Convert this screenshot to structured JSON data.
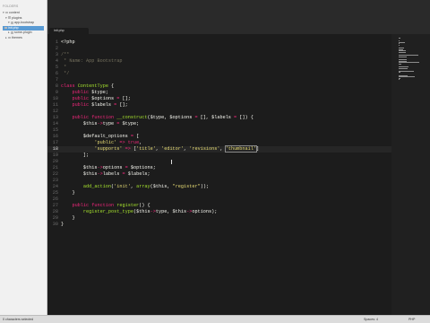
{
  "sidebar": {
    "header": "FOLDERS",
    "items": [
      {
        "label": "content",
        "caret": "▾",
        "depth": 0
      },
      {
        "label": "plugins",
        "caret": "▾",
        "depth": 1
      },
      {
        "label": "app-bootstrap",
        "caret": "▾",
        "depth": 2
      },
      {
        "label": "init.php",
        "caret": "",
        "depth": 3,
        "selected": true
      },
      {
        "label": "some-plugin",
        "caret": "▸",
        "depth": 2
      },
      {
        "label": "themes",
        "caret": "▸",
        "depth": 1
      }
    ]
  },
  "tab": {
    "label": "init.php"
  },
  "editor": {
    "current_line": 18,
    "lines": [
      [
        [
          "<?php",
          "v"
        ]
      ],
      [
        [
          "",
          ""
        ]
      ],
      [
        [
          "/**",
          "c"
        ]
      ],
      [
        [
          " * Name: App Bootstrap",
          "c"
        ]
      ],
      [
        [
          " *",
          "c"
        ]
      ],
      [
        [
          " */",
          "c"
        ]
      ],
      [
        [
          "",
          ""
        ]
      ],
      [
        [
          "class ",
          "k"
        ],
        [
          "ContentType",
          "f"
        ],
        [
          " {",
          "v"
        ]
      ],
      [
        [
          "    ",
          ""
        ],
        [
          "public ",
          "k"
        ],
        [
          "$type;",
          "v"
        ]
      ],
      [
        [
          "    ",
          ""
        ],
        [
          "public ",
          "k"
        ],
        [
          "$options ",
          "v"
        ],
        [
          "= ",
          "k"
        ],
        [
          "[];",
          "v"
        ]
      ],
      [
        [
          "    ",
          ""
        ],
        [
          "public ",
          "k"
        ],
        [
          "$labels ",
          "v"
        ],
        [
          "= ",
          "k"
        ],
        [
          "[];",
          "v"
        ]
      ],
      [
        [
          "",
          ""
        ]
      ],
      [
        [
          "    ",
          ""
        ],
        [
          "public function ",
          "k"
        ],
        [
          "__construct",
          "f"
        ],
        [
          "($type, $options ",
          "v"
        ],
        [
          "= ",
          "k"
        ],
        [
          "[], $labels ",
          "v"
        ],
        [
          "= ",
          "k"
        ],
        [
          "[]) {",
          "v"
        ]
      ],
      [
        [
          "        $this",
          "v"
        ],
        [
          "->",
          "k"
        ],
        [
          "type ",
          "v"
        ],
        [
          "= ",
          "k"
        ],
        [
          "$type;",
          "v"
        ]
      ],
      [
        [
          "",
          ""
        ]
      ],
      [
        [
          "        $default_options ",
          "v"
        ],
        [
          "= ",
          "k"
        ],
        [
          "[",
          "v"
        ]
      ],
      [
        [
          "            ",
          ""
        ],
        [
          "'public' ",
          "s"
        ],
        [
          "=> ",
          "k"
        ],
        [
          "true",
          "k"
        ],
        [
          ",",
          "v"
        ]
      ],
      [
        [
          "            ",
          ""
        ],
        [
          "'supports' ",
          "s"
        ],
        [
          "=> ",
          "k"
        ],
        [
          "[",
          "v"
        ],
        [
          "'title'",
          "s"
        ],
        [
          ", ",
          "v"
        ],
        [
          "'editor'",
          "s"
        ],
        [
          ", ",
          "v"
        ],
        [
          "'revisions'",
          "s"
        ],
        [
          ", ",
          "v"
        ],
        [
          "'thumbnail'",
          "s"
        ],
        [
          "]",
          "v"
        ]
      ],
      [
        [
          "        ];",
          "v"
        ]
      ],
      [
        [
          "",
          ""
        ]
      ],
      [
        [
          "        $this",
          "v"
        ],
        [
          "->",
          "k"
        ],
        [
          "options ",
          "v"
        ],
        [
          "= ",
          "k"
        ],
        [
          "$options;",
          "v"
        ]
      ],
      [
        [
          "        $this",
          "v"
        ],
        [
          "->",
          "k"
        ],
        [
          "labels ",
          "v"
        ],
        [
          "= ",
          "k"
        ],
        [
          "$labels;",
          "v"
        ]
      ],
      [
        [
          "",
          ""
        ]
      ],
      [
        [
          "        ",
          ""
        ],
        [
          "add_action",
          "f"
        ],
        [
          "(",
          "v"
        ],
        [
          "'init'",
          "s"
        ],
        [
          ", ",
          "v"
        ],
        [
          "array",
          "f"
        ],
        [
          "($this, ",
          "v"
        ],
        [
          "\"register\"",
          "s"
        ],
        [
          "));",
          "v"
        ]
      ],
      [
        [
          "    }",
          "v"
        ]
      ],
      [
        [
          "",
          ""
        ]
      ],
      [
        [
          "    ",
          ""
        ],
        [
          "public function ",
          "k"
        ],
        [
          "register",
          "f"
        ],
        [
          "() {",
          "v"
        ]
      ],
      [
        [
          "        ",
          ""
        ],
        [
          "register_post_type",
          "f"
        ],
        [
          "($this",
          "v"
        ],
        [
          "->",
          "k"
        ],
        [
          "type, $this",
          "v"
        ],
        [
          "->",
          "k"
        ],
        [
          "options);",
          "v"
        ]
      ],
      [
        [
          "    }",
          "v"
        ]
      ],
      [
        [
          "}",
          "v"
        ]
      ]
    ]
  },
  "status": {
    "left": "0 characters selected",
    "spaces": "Spaces: 4",
    "syntax": "PHP"
  }
}
